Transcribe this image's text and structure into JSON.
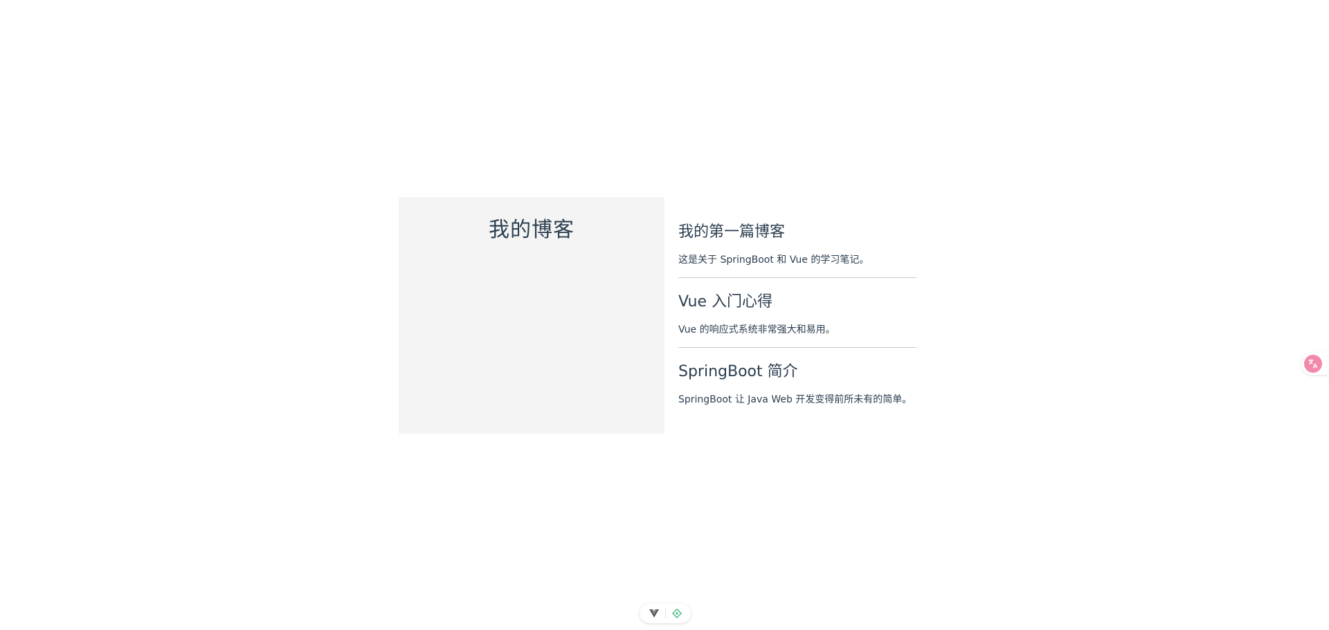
{
  "sidebar": {
    "title": "我的博客"
  },
  "posts": [
    {
      "title": "我的第一篇博客",
      "summary": "这是关于 SpringBoot 和 Vue 的学习笔记。"
    },
    {
      "title": "Vue 入门心得",
      "summary": "Vue 的响应式系统非常强大和易用。"
    },
    {
      "title": "SpringBoot 简介",
      "summary": "SpringBoot 让 Java Web 开发变得前所未有的简单。"
    }
  ],
  "translate_widget": {
    "icon": "translate-icon",
    "color": "#f08aa8"
  },
  "devtools": {
    "icons": [
      "vue-logo-icon",
      "inspect-icon"
    ],
    "accent": "#42b883"
  }
}
